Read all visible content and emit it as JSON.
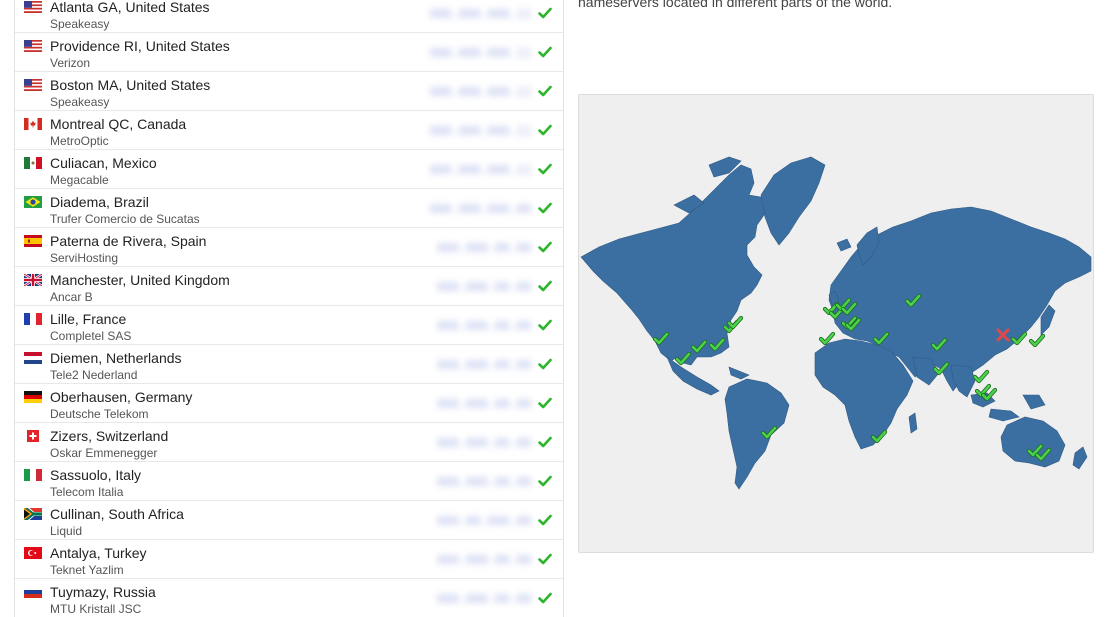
{
  "colors": {
    "check": "#2db52d",
    "land": "#3c6fa1",
    "map_bg": "#efefef",
    "fail": "#e24848"
  },
  "description": "nameservers located in different parts of the world.",
  "results": [
    {
      "location": "Atlanta GA, United States",
      "isp": "Speakeasy",
      "ip": "000.000.000.11",
      "flag": "us",
      "status": "ok"
    },
    {
      "location": "Providence RI, United States",
      "isp": "Verizon",
      "ip": "000.000.000.11",
      "flag": "us",
      "status": "ok"
    },
    {
      "location": "Boston MA, United States",
      "isp": "Speakeasy",
      "ip": "000.000.000.11",
      "flag": "us",
      "status": "ok"
    },
    {
      "location": "Montreal QC, Canada",
      "isp": "MetroOptic",
      "ip": "000.000.000.11",
      "flag": "ca",
      "status": "ok"
    },
    {
      "location": "Culiacan, Mexico",
      "isp": "Megacable",
      "ip": "000.000.000.11",
      "flag": "mx",
      "status": "ok"
    },
    {
      "location": "Diadema, Brazil",
      "isp": "Trufer Comercio de Sucatas",
      "ip": "000.000.000.00",
      "flag": "br",
      "status": "ok"
    },
    {
      "location": "Paterna de Rivera, Spain",
      "isp": "ServiHosting",
      "ip": "000.000.00.00",
      "flag": "es",
      "status": "ok"
    },
    {
      "location": "Manchester, United Kingdom",
      "isp": "Ancar B",
      "ip": "000.000.00.00",
      "flag": "gb",
      "status": "ok"
    },
    {
      "location": "Lille, France",
      "isp": "Completel SAS",
      "ip": "000.000.00.00",
      "flag": "fr",
      "status": "ok"
    },
    {
      "location": "Diemen, Netherlands",
      "isp": "Tele2 Nederland",
      "ip": "000.000.00.00",
      "flag": "nl",
      "status": "ok"
    },
    {
      "location": "Oberhausen, Germany",
      "isp": "Deutsche Telekom",
      "ip": "000.000.00.00",
      "flag": "de",
      "status": "ok"
    },
    {
      "location": "Zizers, Switzerland",
      "isp": "Oskar Emmenegger",
      "ip": "000.000.00.00",
      "flag": "ch",
      "status": "ok"
    },
    {
      "location": "Sassuolo, Italy",
      "isp": "Telecom Italia",
      "ip": "000.000.00.00",
      "flag": "it",
      "status": "ok"
    },
    {
      "location": "Cullinan, South Africa",
      "isp": "Liquid",
      "ip": "000.00.000.00",
      "flag": "za",
      "status": "ok"
    },
    {
      "location": "Antalya, Turkey",
      "isp": "Teknet Yazlim",
      "ip": "000.000.00.00",
      "flag": "tr",
      "status": "ok"
    },
    {
      "location": "Tuymazy, Russia",
      "isp": "MTU Kristall JSC",
      "ip": "000.000.00.00",
      "flag": "ru",
      "status": "ok"
    }
  ],
  "map": {
    "status_names": [
      "ok",
      "fail"
    ],
    "markers": [
      {
        "place": "US West",
        "status": "ok"
      },
      {
        "place": "Mexico",
        "status": "ok"
      },
      {
        "place": "US Central",
        "status": "ok"
      },
      {
        "place": "US South",
        "status": "ok"
      },
      {
        "place": "US East",
        "status": "ok"
      },
      {
        "place": "Montreal",
        "status": "ok"
      },
      {
        "place": "Brazil",
        "status": "ok"
      },
      {
        "place": "UK",
        "status": "ok"
      },
      {
        "place": "France",
        "status": "ok"
      },
      {
        "place": "Netherlands",
        "status": "ok"
      },
      {
        "place": "Germany",
        "status": "ok"
      },
      {
        "place": "Switzerland",
        "status": "ok"
      },
      {
        "place": "Italy",
        "status": "ok"
      },
      {
        "place": "Spain",
        "status": "ok"
      },
      {
        "place": "Turkey",
        "status": "ok"
      },
      {
        "place": "Russia",
        "status": "ok"
      },
      {
        "place": "South Africa",
        "status": "ok"
      },
      {
        "place": "Pakistan",
        "status": "ok"
      },
      {
        "place": "India",
        "status": "ok"
      },
      {
        "place": "Thailand",
        "status": "ok"
      },
      {
        "place": "Malaysia",
        "status": "ok"
      },
      {
        "place": "Indonesia",
        "status": "ok"
      },
      {
        "place": "China",
        "status": "fail"
      },
      {
        "place": "Korea",
        "status": "ok"
      },
      {
        "place": "Japan",
        "status": "ok"
      },
      {
        "place": "Australia",
        "status": "ok"
      },
      {
        "place": "Australia 2",
        "status": "ok"
      }
    ]
  }
}
